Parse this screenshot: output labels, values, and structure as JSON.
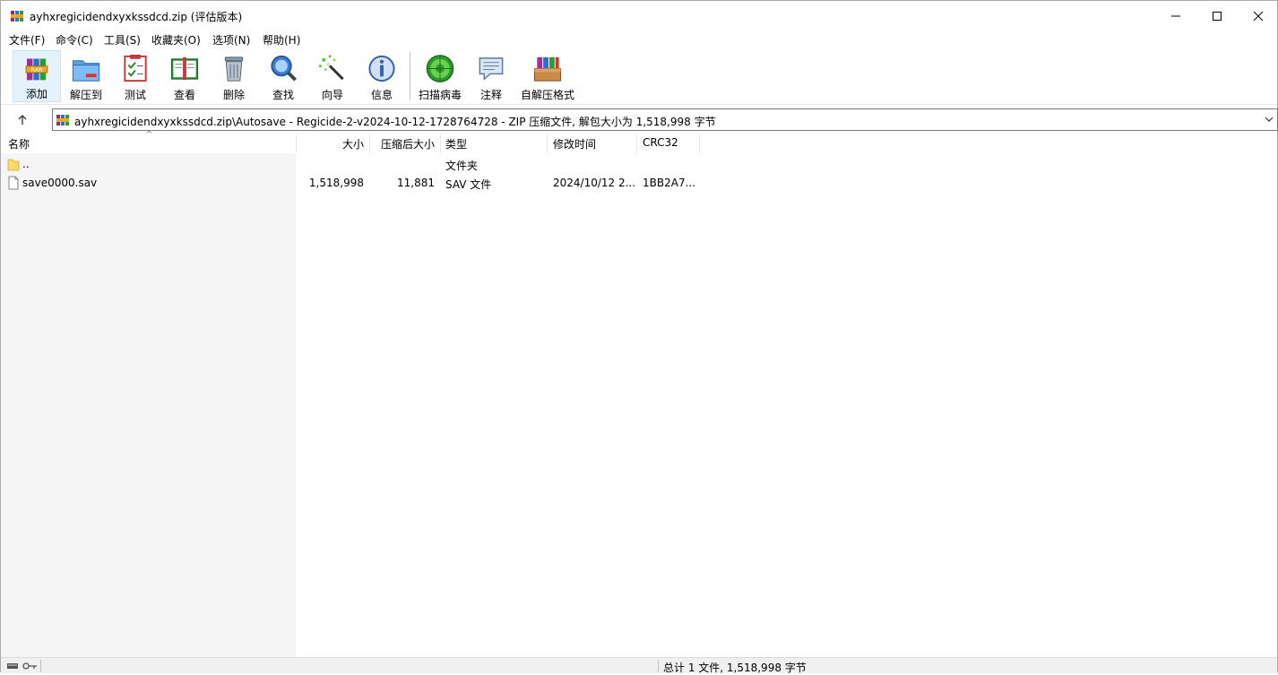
{
  "window": {
    "title": "ayhxregicidendxyxkssdcd.zip (评估版本)",
    "controls": [
      "minimize-icon",
      "maximize-icon",
      "close-icon"
    ]
  },
  "menu": {
    "items": [
      "文件(F)",
      "命令(C)",
      "工具(S)",
      "收藏夹(O)",
      "选项(N)",
      "帮助(H)"
    ]
  },
  "toolbar": {
    "buttons": [
      {
        "label": "添加",
        "icon": "add-archive-icon"
      },
      {
        "label": "解压到",
        "icon": "extract-folder-icon"
      },
      {
        "label": "测试",
        "icon": "test-checklist-icon"
      },
      {
        "label": "查看",
        "icon": "view-book-icon"
      },
      {
        "label": "删除",
        "icon": "trash-icon"
      },
      {
        "label": "查找",
        "icon": "magnifier-icon"
      },
      {
        "label": "向导",
        "icon": "wizard-wand-icon"
      },
      {
        "label": "信息",
        "icon": "info-icon"
      },
      {
        "label": "扫描病毒",
        "icon": "virus-scan-icon"
      },
      {
        "label": "注释",
        "icon": "comment-icon"
      },
      {
        "label": "自解压格式",
        "icon": "sfx-archive-icon"
      }
    ]
  },
  "address": {
    "text": "ayhxregicidendxyxkssdcd.zip\\Autosave - Regicide-2-v2024-10-12-1728764728 - ZIP 压缩文件, 解包大小为 1,518,998 字节"
  },
  "columns": {
    "name": "名称",
    "size": "大小",
    "packed": "压缩后大小",
    "type": "类型",
    "modified": "修改时间",
    "crc": "CRC32"
  },
  "rows": [
    {
      "name": "..",
      "size": "",
      "packed": "",
      "type": "文件夹",
      "modified": "",
      "crc": ""
    },
    {
      "name": "save0000.sav",
      "size": "1,518,998",
      "packed": "11,881",
      "type": "SAV 文件",
      "modified": "2024/10/12 2...",
      "crc": "1BB2A7..."
    }
  ],
  "status": {
    "text": "总计 1 文件, 1,518,998 字节"
  },
  "colors": {
    "accent_active": "#e5f1fb",
    "folder_yellow": "#ffd966",
    "statusbar_bg": "#f0f0f0"
  }
}
